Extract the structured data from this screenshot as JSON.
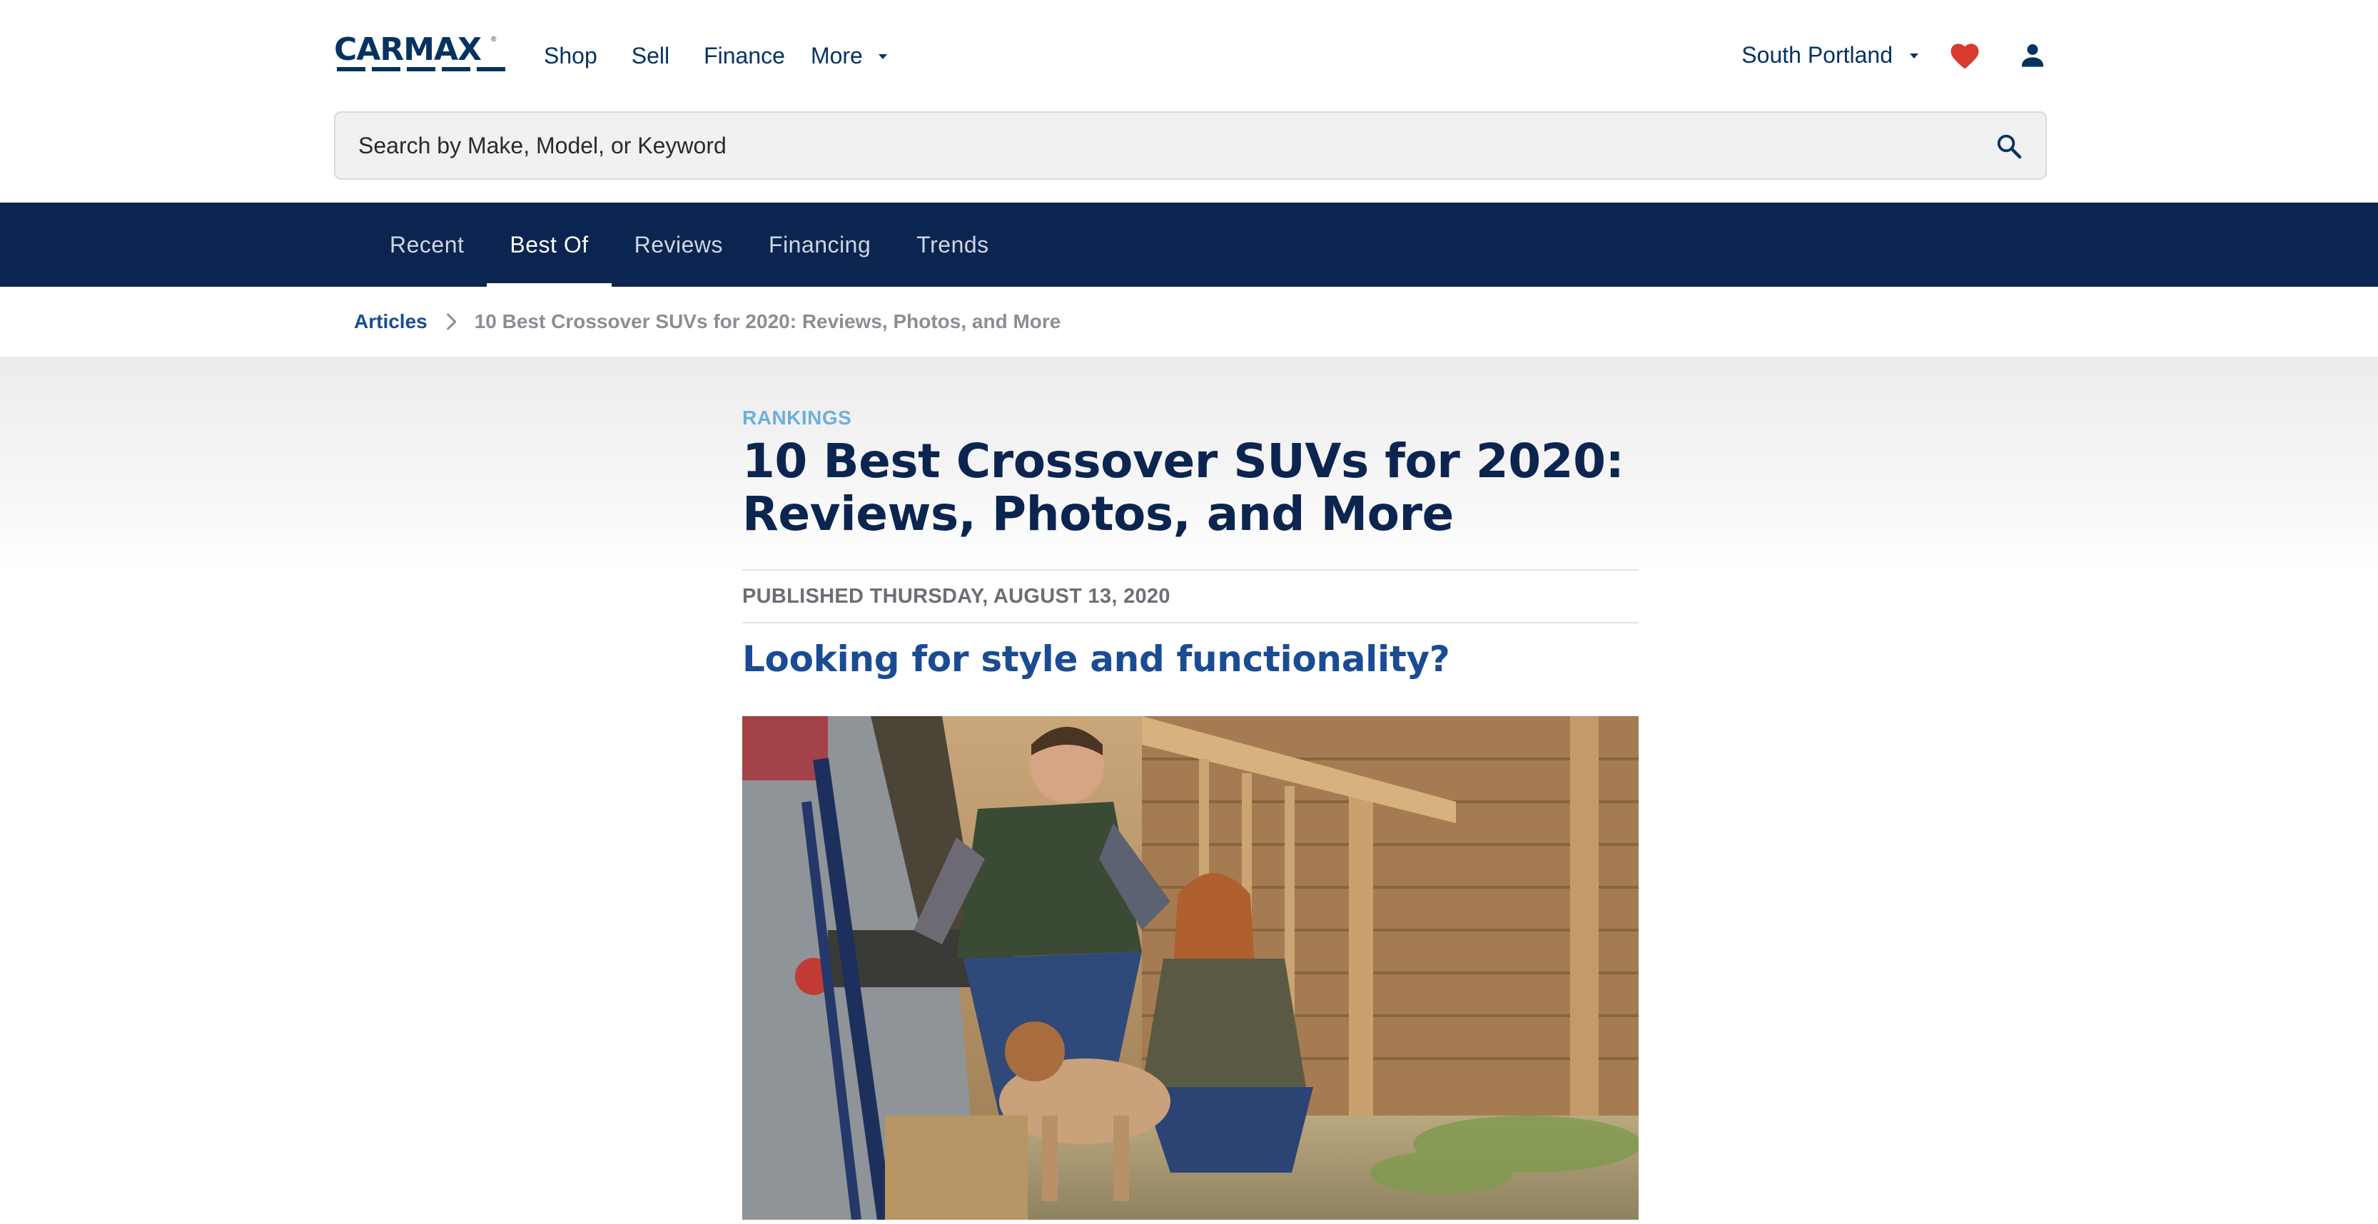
{
  "header": {
    "logo_text": "CARMAX",
    "logo_reg": "®",
    "nav": [
      {
        "label": "Shop"
      },
      {
        "label": "Sell"
      },
      {
        "label": "Finance"
      }
    ],
    "more_label": "More",
    "location": "South Portland",
    "icons": {
      "favorites": "heart-icon",
      "account": "user-icon",
      "search": "search-icon"
    },
    "colors": {
      "brand": "#053361",
      "heart": "#d83a2e"
    }
  },
  "search": {
    "placeholder": "Search by Make, Model, or Keyword"
  },
  "subnav": {
    "tabs": [
      {
        "label": "Recent"
      },
      {
        "label": "Best Of"
      },
      {
        "label": "Reviews"
      },
      {
        "label": "Financing"
      },
      {
        "label": "Trends"
      }
    ],
    "active": "Best Of",
    "background": "#0b2550"
  },
  "breadcrumb": {
    "root": "Articles",
    "current": "10 Best Crossover SUVs for 2020: Reviews, Photos, and More"
  },
  "article": {
    "category": "RANKINGS",
    "title_line1": "10 Best Crossover SUVs for 2020:",
    "title_line2": "Reviews, Photos, and More",
    "published": "PUBLISHED THURSDAY, AUGUST 13, 2020",
    "subtitle": "Looking for style and functionality?"
  }
}
